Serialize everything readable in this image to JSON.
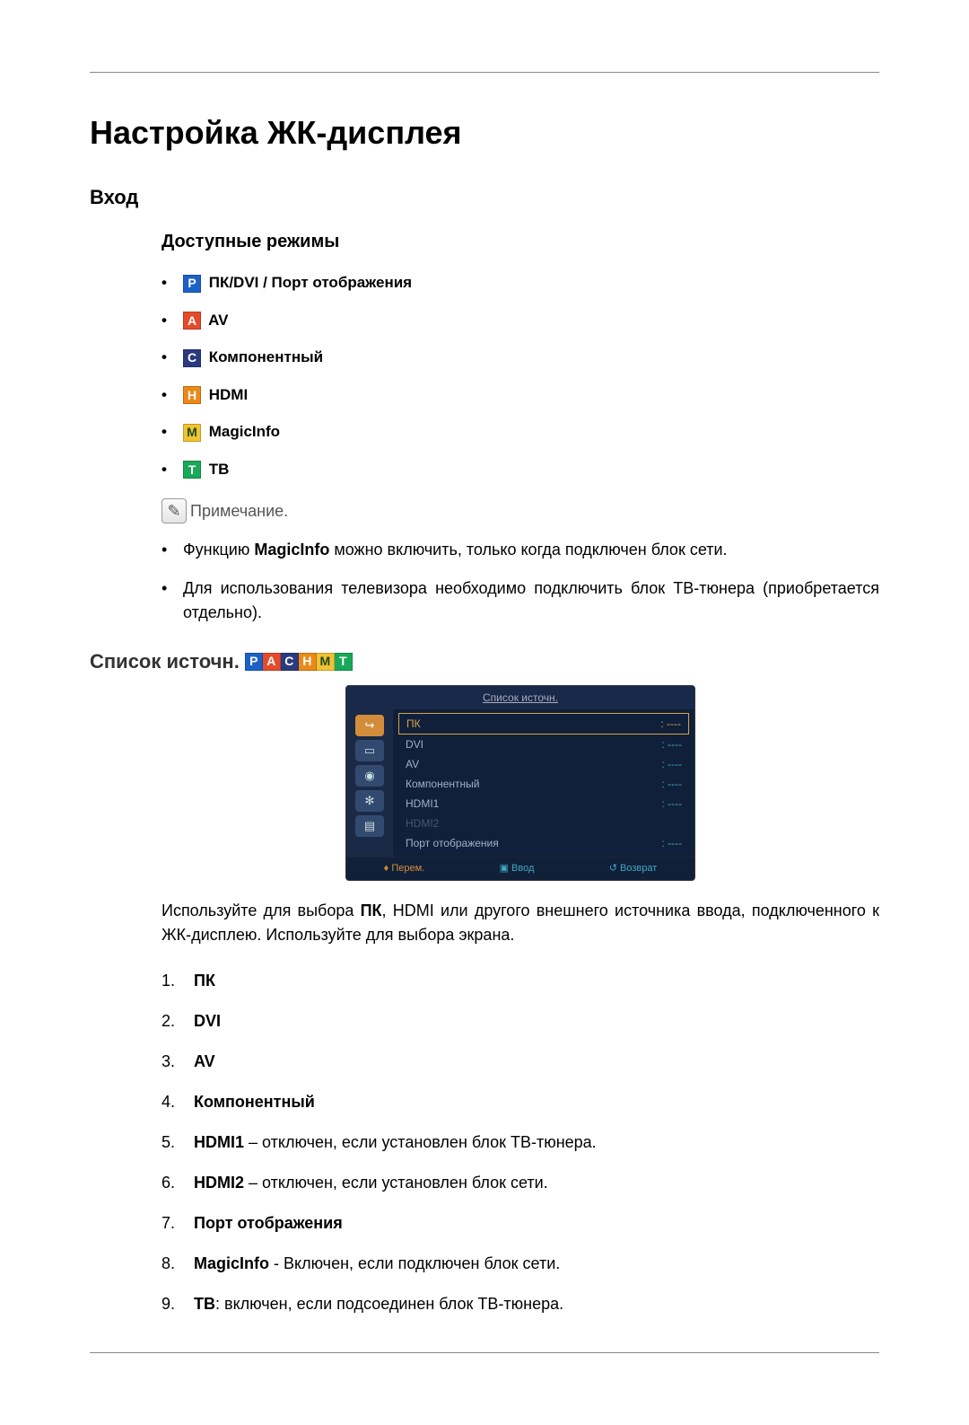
{
  "title": "Настройка ЖК-дисплея",
  "input_heading": "Вход",
  "modes_heading": "Доступные режимы",
  "modes": [
    {
      "letter": "P",
      "color": "#1b61c8",
      "label": "ПК/DVI / Порт отображения"
    },
    {
      "letter": "A",
      "color": "#e44b2b",
      "label": "AV"
    },
    {
      "letter": "C",
      "color": "#2c3a7f",
      "label": "Компонентный"
    },
    {
      "letter": "H",
      "color": "#e98a1a",
      "label": "HDMI"
    },
    {
      "letter": "M",
      "color": "#f2c233",
      "label": "MagicInfo"
    },
    {
      "letter": "T",
      "color": "#1aa85a",
      "label": "ТВ"
    }
  ],
  "note_label": "Примечание.",
  "notes": [
    {
      "prefix": "Функцию ",
      "bold": "MagicInfo",
      "suffix": " можно включить, только когда подключен блок сети."
    },
    {
      "prefix": "Для использования телевизора необходимо подключить блок ТВ-тюнера (приобретается отдельно).",
      "bold": "",
      "suffix": ""
    }
  ],
  "source_heading": "Список источн.",
  "osd": {
    "title": "Список источн.",
    "rows": [
      {
        "label": "ПК",
        "value": ": ----",
        "highlight": true
      },
      {
        "label": "DVI",
        "value": ": ----"
      },
      {
        "label": "AV",
        "value": ": ----"
      },
      {
        "label": "Компонентный",
        "value": ": ----"
      },
      {
        "label": "HDMI1",
        "value": ": ----"
      },
      {
        "label": "HDMI2",
        "value": "",
        "dim": true
      },
      {
        "label": "Порт отображения",
        "value": ": ----"
      }
    ],
    "footer": {
      "move": "Перем.",
      "enter": "Ввод",
      "back": "Возврат"
    }
  },
  "description_prefix": "Используйте для выбора ",
  "description_bold": "ПК",
  "description_suffix": ", HDMI или другого внешнего источника ввода, подключенного к ЖК-дисплею. Используйте для выбора экрана.",
  "source_items": [
    {
      "bold": "ПК",
      "rest": ""
    },
    {
      "bold": "DVI",
      "rest": ""
    },
    {
      "bold": "AV",
      "rest": ""
    },
    {
      "bold": "Компонентный",
      "rest": ""
    },
    {
      "bold": "HDMI1",
      "rest": " – отключен, если установлен блок ТВ-тюнера."
    },
    {
      "bold": "HDMI2",
      "rest": " – отключен, если установлен блок сети."
    },
    {
      "bold": "Порт отображения",
      "rest": ""
    },
    {
      "bold": "MagicInfo",
      "rest": " - Включен, если подключен блок сети."
    },
    {
      "bold": "ТВ",
      "rest": ": включен, если подсоединен блок ТВ-тюнера."
    }
  ]
}
